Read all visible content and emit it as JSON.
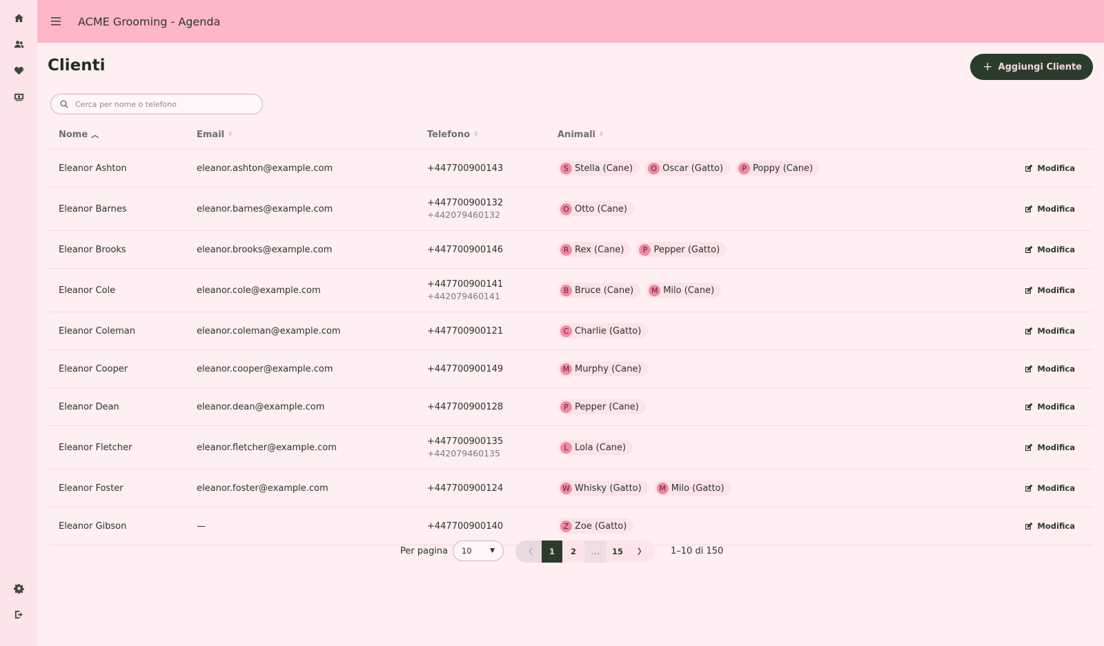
{
  "sidebar": {
    "items": [
      {
        "icon": "home-icon",
        "label": "Home"
      },
      {
        "icon": "users-icon",
        "label": "Clienti"
      },
      {
        "icon": "heart-icon",
        "label": "Animali"
      },
      {
        "icon": "money-icon",
        "label": "Pagamenti"
      }
    ],
    "bottom_items": [
      {
        "icon": "gear-icon",
        "label": "Impostazioni"
      },
      {
        "icon": "logout-icon",
        "label": "Esci"
      }
    ]
  },
  "topbar": {
    "title": "ACME Grooming - Agenda"
  },
  "page": {
    "title": "Clienti",
    "add_button": "Aggiungi Cliente",
    "search_placeholder": "Cerca per nome o telefono"
  },
  "table": {
    "headers": {
      "name": "Nome",
      "email": "Email",
      "phone": "Telefono",
      "pets": "Animali"
    },
    "sort": {
      "column": "name",
      "direction": "asc"
    },
    "edit_label": "Modifica",
    "rows": [
      {
        "name": "Eleanor Ashton",
        "email": "eleanor.ashton@example.com",
        "phone": "+447700900143",
        "phone2": "",
        "pets": [
          {
            "initial": "S",
            "label": "Stella (Cane)"
          },
          {
            "initial": "O",
            "label": "Oscar (Gatto)"
          },
          {
            "initial": "P",
            "label": "Poppy (Cane)"
          }
        ]
      },
      {
        "name": "Eleanor Barnes",
        "email": "eleanor.barnes@example.com",
        "phone": "+447700900132",
        "phone2": "+442079460132",
        "pets": [
          {
            "initial": "O",
            "label": "Otto (Cane)"
          }
        ]
      },
      {
        "name": "Eleanor Brooks",
        "email": "eleanor.brooks@example.com",
        "phone": "+447700900146",
        "phone2": "",
        "pets": [
          {
            "initial": "R",
            "label": "Rex (Cane)"
          },
          {
            "initial": "P",
            "label": "Pepper (Gatto)"
          }
        ]
      },
      {
        "name": "Eleanor Cole",
        "email": "eleanor.cole@example.com",
        "phone": "+447700900141",
        "phone2": "+442079460141",
        "pets": [
          {
            "initial": "B",
            "label": "Bruce (Cane)"
          },
          {
            "initial": "M",
            "label": "Milo (Cane)"
          }
        ]
      },
      {
        "name": "Eleanor Coleman",
        "email": "eleanor.coleman@example.com",
        "phone": "+447700900121",
        "phone2": "",
        "pets": [
          {
            "initial": "C",
            "label": "Charlie (Gatto)"
          }
        ]
      },
      {
        "name": "Eleanor Cooper",
        "email": "eleanor.cooper@example.com",
        "phone": "+447700900149",
        "phone2": "",
        "pets": [
          {
            "initial": "M",
            "label": "Murphy (Cane)"
          }
        ]
      },
      {
        "name": "Eleanor Dean",
        "email": "eleanor.dean@example.com",
        "phone": "+447700900128",
        "phone2": "",
        "pets": [
          {
            "initial": "P",
            "label": "Pepper (Cane)"
          }
        ]
      },
      {
        "name": "Eleanor Fletcher",
        "email": "eleanor.fletcher@example.com",
        "phone": "+447700900135",
        "phone2": "+442079460135",
        "pets": [
          {
            "initial": "L",
            "label": "Lola (Cane)"
          }
        ]
      },
      {
        "name": "Eleanor Foster",
        "email": "eleanor.foster@example.com",
        "phone": "+447700900124",
        "phone2": "",
        "pets": [
          {
            "initial": "W",
            "label": "Whisky (Gatto)"
          },
          {
            "initial": "M",
            "label": "Milo (Gatto)"
          }
        ]
      },
      {
        "name": "Eleanor Gibson",
        "email": "—",
        "phone": "+447700900140",
        "phone2": "",
        "pets": [
          {
            "initial": "Z",
            "label": "Zoe (Gatto)"
          }
        ]
      }
    ]
  },
  "pagination": {
    "per_page_label": "Per pagina",
    "per_page_value": "10",
    "pages": [
      "1",
      "2",
      "...",
      "15"
    ],
    "current_page": "1",
    "range_text": "1–10 di 150"
  }
}
